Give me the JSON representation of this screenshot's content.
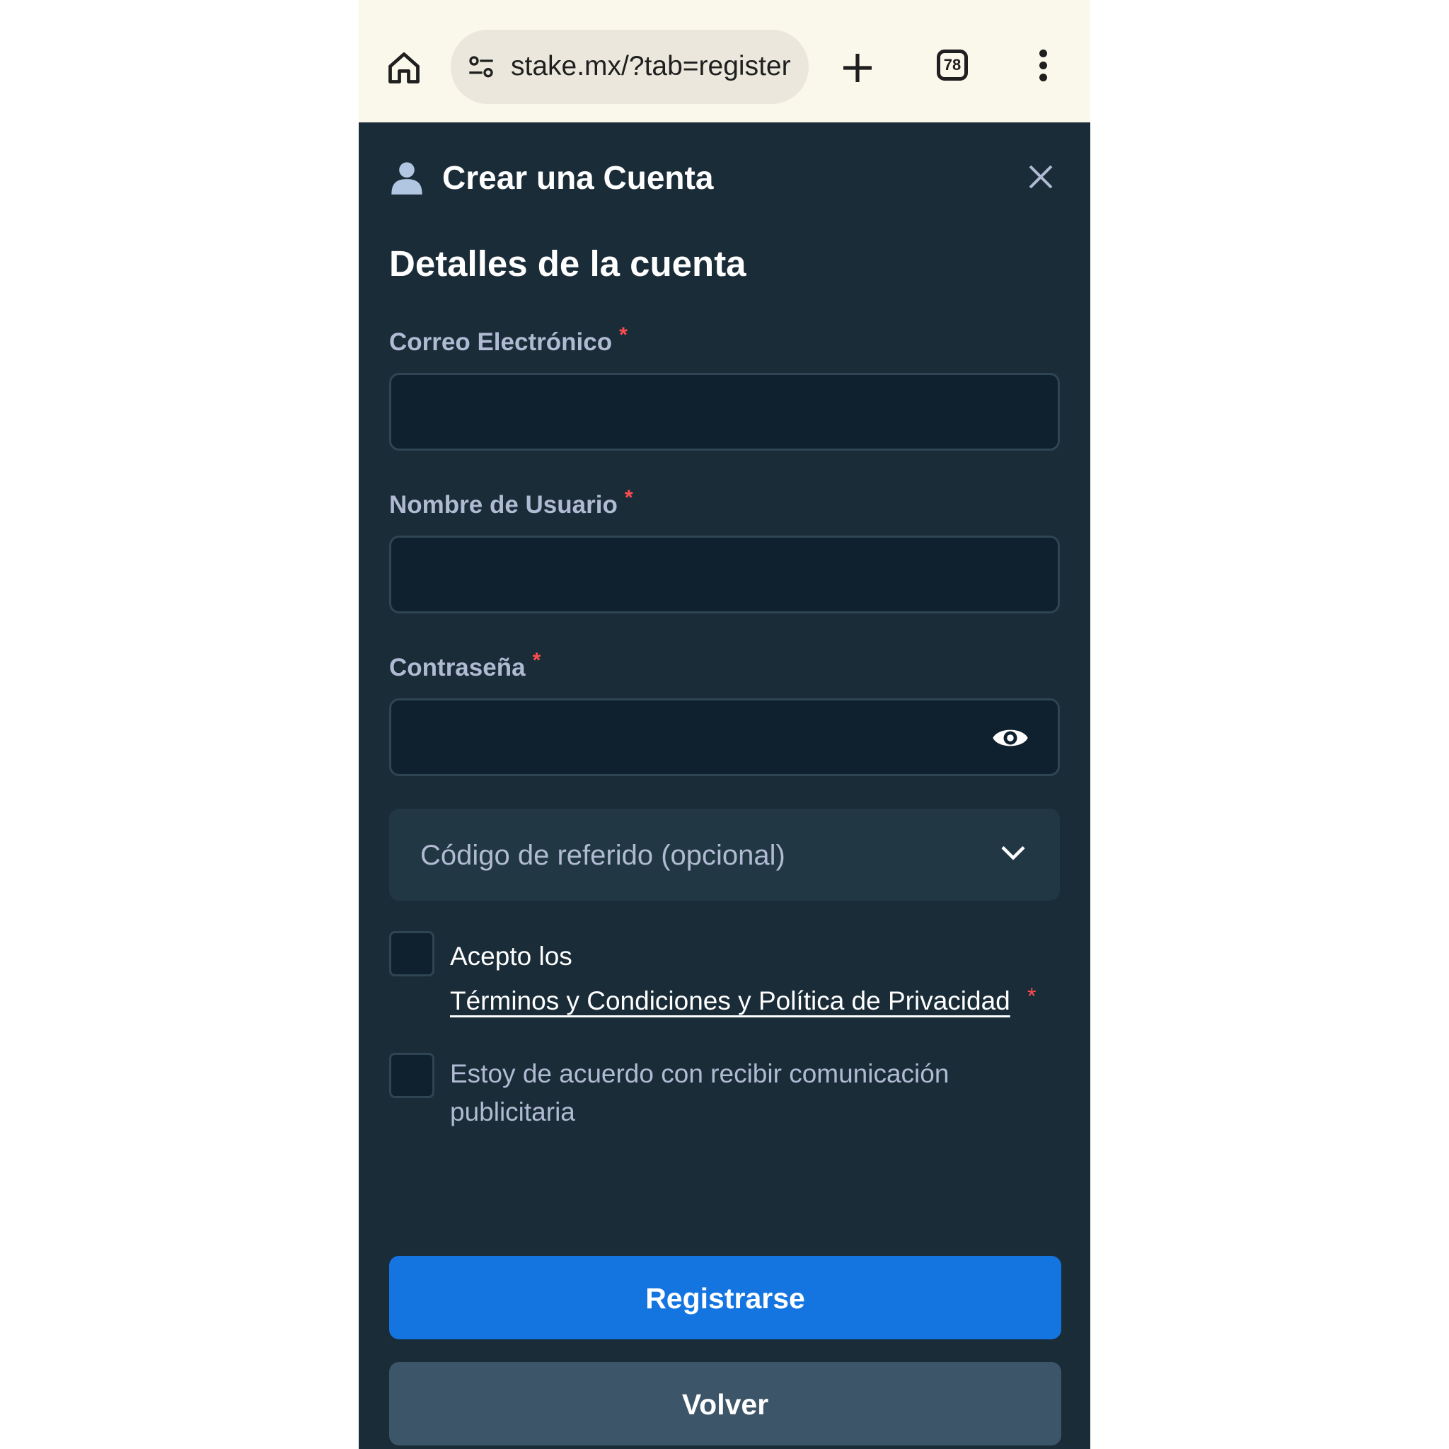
{
  "browser": {
    "url": "stake.mx/?tab=register",
    "tab_count": "78"
  },
  "modal": {
    "title": "Crear una Cuenta",
    "section_title": "Detalles de la cuenta"
  },
  "form": {
    "email_label": "Correo Electrónico",
    "username_label": "Nombre de Usuario",
    "password_label": "Contraseña",
    "required_mark": "*",
    "email_value": "",
    "username_value": "",
    "password_value": "",
    "referral_label": "Código de referido (opcional)",
    "accept_prefix": "Acepto los",
    "terms_link": "Términos y Condiciones y Política de Privacidad",
    "promo_consent": "Estoy de acuerdo con recibir comunicación publicitaria",
    "register_button": "Registrarse",
    "back_button": "Volver"
  },
  "colors": {
    "background": "#1a2c38",
    "input_bg": "#0f212e",
    "primary": "#1475e1",
    "required": "#ff4d4f"
  }
}
